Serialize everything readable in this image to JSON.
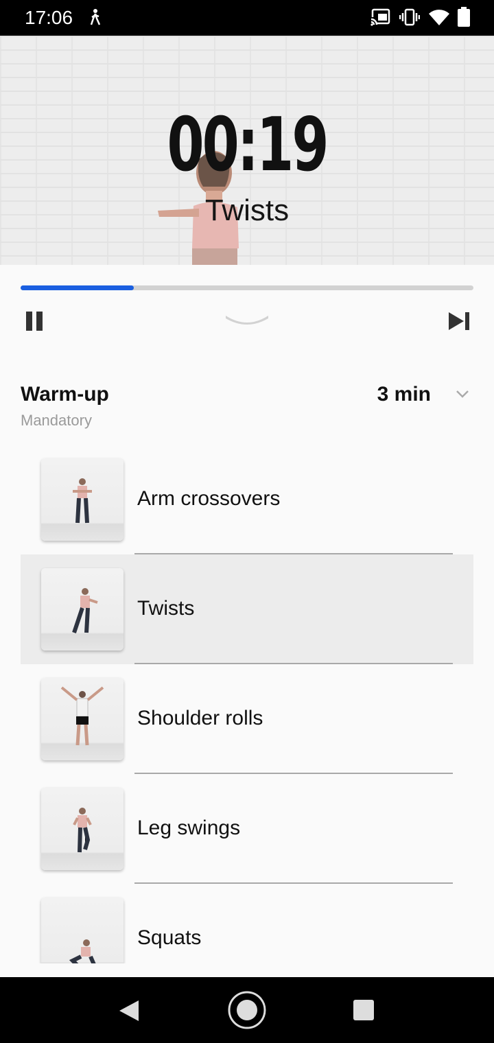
{
  "status_bar": {
    "time": "17:06",
    "icons": [
      "walking-icon",
      "cast-icon",
      "vibrate-icon",
      "wifi-icon",
      "battery-icon"
    ]
  },
  "player": {
    "timer": "00:19",
    "current_exercise": "Twists",
    "progress_fraction": 0.25,
    "accent_color": "#1a5fe0",
    "controls": [
      "pause-icon",
      "chevron-down-icon",
      "skip-next-icon"
    ]
  },
  "section": {
    "title": "Warm-up",
    "subtitle": "Mandatory",
    "duration": "3 min",
    "expand_icon": "chevron-down-icon"
  },
  "exercises": [
    {
      "name": "Arm crossovers",
      "active": false
    },
    {
      "name": "Twists",
      "active": true
    },
    {
      "name": "Shoulder rolls",
      "active": false
    },
    {
      "name": "Leg swings",
      "active": false
    },
    {
      "name": "Squats",
      "active": false
    }
  ],
  "nav_bar": {
    "icons": [
      "back-icon",
      "home-icon",
      "recents-icon"
    ]
  }
}
